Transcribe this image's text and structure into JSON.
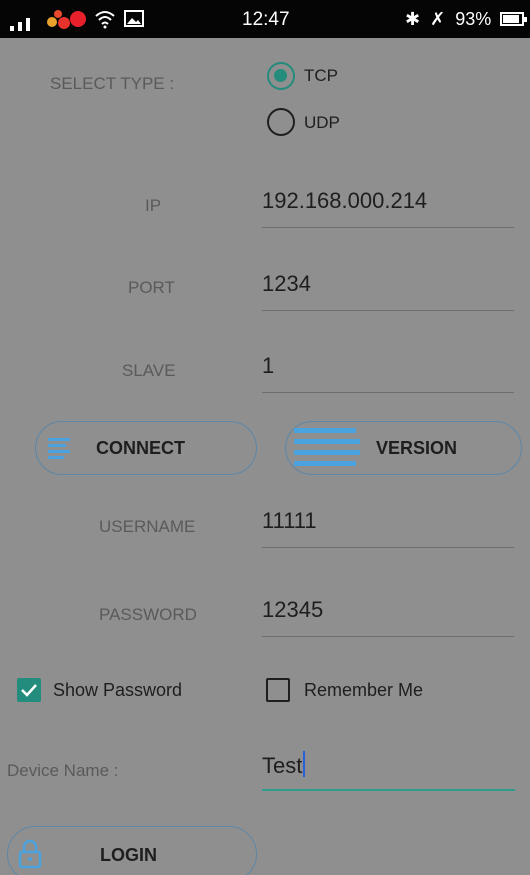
{
  "status_bar": {
    "time": "12:47",
    "battery": "93%"
  },
  "select_type": {
    "label": "SELECT TYPE :",
    "options": [
      "TCP",
      "UDP"
    ],
    "selected": "TCP"
  },
  "ip": {
    "label": "IP",
    "value": "192.168.000.214"
  },
  "port": {
    "label": "PORT",
    "value": "1234"
  },
  "slave": {
    "label": "SLAVE",
    "value": "1"
  },
  "buttons": {
    "connect": "CONNECT",
    "version": "VERSION",
    "login": "LOGIN"
  },
  "username": {
    "label": "USERNAME",
    "value": "11111"
  },
  "password": {
    "label": "PASSWORD",
    "value": "12345"
  },
  "show_password": {
    "label": "Show Password",
    "checked": true
  },
  "remember_me": {
    "label": "Remember Me",
    "checked": false
  },
  "device_name": {
    "label": "Device Name :",
    "value": "Test"
  },
  "colors": {
    "background": "#8f8f8f",
    "accent": "#238c7c",
    "button_icon": "#4aa3df",
    "status_bar": "#050505"
  },
  "icons": [
    "signal-icon",
    "notification-dots-icon",
    "wifi-icon",
    "image-icon",
    "bluetooth-icon",
    "mute-icon",
    "battery-icon",
    "list-icon",
    "menu-bars-icon",
    "lock-icon",
    "check-icon"
  ]
}
